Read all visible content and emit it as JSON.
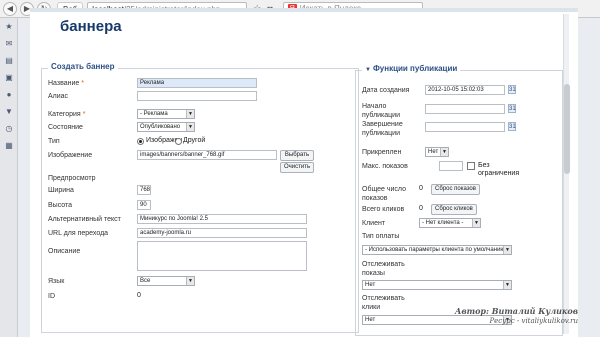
{
  "browser": {
    "tab_label": "Веб",
    "url_host": "localhost",
    "url_path": "/25/administrator/index.php",
    "search_placeholder": "Искать в Яндекс",
    "yandex_badge": "Я"
  },
  "page": {
    "title": "баннера"
  },
  "left_panel": {
    "legend": "Создать баннер",
    "name_label": "Название",
    "name_value": "Реклама",
    "alias_label": "Алиас",
    "alias_value": "",
    "category_label": "Категория",
    "category_value": "- Реклама",
    "state_label": "Состояние",
    "state_value": "Опубликовано",
    "type_label": "Тип",
    "type_option1": "Изображен",
    "type_option2": "Другой",
    "image_label": "Изображение",
    "image_value": "images/banners/banner_768.gif",
    "select_button": "Выбрать",
    "clear_button": "Очистить",
    "preview_label": "Предпросмотр",
    "width_label": "Ширина",
    "width_value": "768",
    "height_label": "Высота",
    "height_value": "90",
    "alt_label": "Альтернативный текст",
    "alt_value": "Миникурс по Joomla! 2.5",
    "link_label": "URL для перехода",
    "link_value": "academy-joomla.ru",
    "description_label": "Описание",
    "language_label": "Язык",
    "language_value": "Все",
    "id_label": "ID",
    "id_value": "0"
  },
  "right_panel": {
    "legend": "Функции публикации",
    "created_label": "Дата создания",
    "created_value": "2012-10-05 15:02:03",
    "publish_up_label_1": "Начало",
    "publish_up_label_2": "публикации",
    "publish_down_label_1": "Завершение",
    "publish_down_label_2": "публикации",
    "pinned_label": "Прикреплен",
    "pinned_value": "Нет",
    "max_impressions_label": "Макс. показов",
    "unlimited_label_1": "Без",
    "unlimited_label_2": "ограничения",
    "total_impressions_label_1": "Общее число",
    "total_impressions_label_2": "показов",
    "total_impressions_value": "0",
    "reset_impressions_button": "Сброс показов",
    "total_clicks_label": "Всего кликов",
    "total_clicks_value": "0",
    "reset_clicks_button": "Сброс кликов",
    "client_label": "Клиент",
    "client_value": "- Нет клиента -",
    "purchase_type_label": "Тип оплаты",
    "purchase_type_value": "- Использовать параметры клиента по умолчанию -",
    "track_impressions_label_1": "Отслеживать",
    "track_impressions_label_2": "показы",
    "track_impressions_value": "Нет",
    "track_clicks_label_1": "Отслеживать",
    "track_clicks_label_2": "клики",
    "track_clicks_value": "Нет"
  },
  "watermark": {
    "author": "Автор: Виталий Куликов",
    "resource": "Ресурс - vitaliykulikov.ru"
  }
}
